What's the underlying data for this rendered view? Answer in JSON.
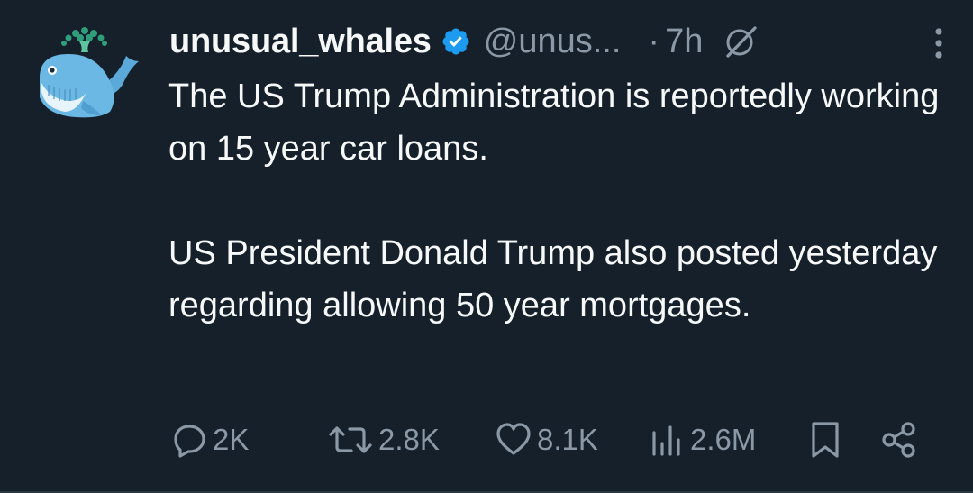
{
  "author": {
    "name": "unusual_whales",
    "handle": "@unus...",
    "time_separator": "·",
    "time": "7h"
  },
  "tweet": {
    "paragraphs": [
      "The US Trump Administration is reportedly working on 15 year car loans.",
      "US President Donald Trump also posted yesterday regarding allowing 50 year mortgages."
    ]
  },
  "actions": {
    "replies": "2K",
    "reposts": "2.8K",
    "likes": "8.1K",
    "views": "2.6M"
  },
  "colors": {
    "background": "#15202b",
    "text": "#f7f9f9",
    "muted": "#8b98a5",
    "verified": "#1d9bf0"
  },
  "icons": {
    "avatar": "whale-avatar",
    "verified": "verified-badge-icon",
    "grok": "grok-icon",
    "more": "more-vertical-icon",
    "reply": "reply-icon",
    "repost": "repost-icon",
    "like": "heart-icon",
    "views": "views-chart-icon",
    "bookmark": "bookmark-icon",
    "share": "share-icon"
  }
}
